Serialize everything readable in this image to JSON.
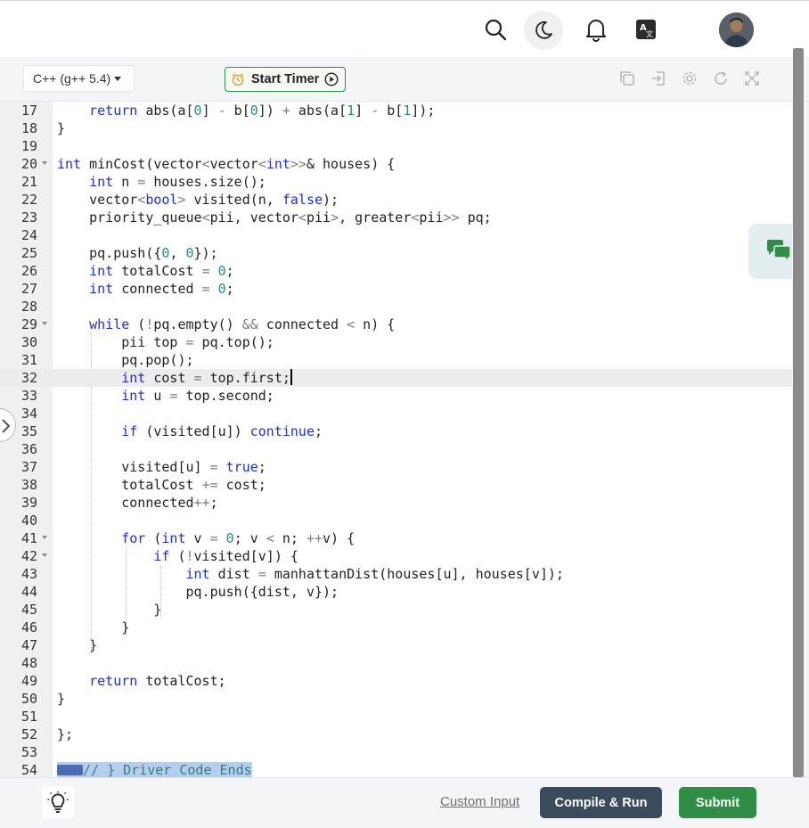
{
  "toolbar": {
    "language": "C++ (g++ 5.4)",
    "timer_label": "Start Timer"
  },
  "icons": {
    "search": "search-icon",
    "theme": "moon-icon",
    "notifications": "bell-icon",
    "translate": "translate-icon",
    "copy": "copy-icon",
    "import": "import-icon",
    "settings": "gear-icon",
    "reset": "refresh-icon",
    "fullscreen": "expand-icon",
    "chat": "chat-icon",
    "hint": "lightbulb-icon"
  },
  "editor": {
    "active_line": "32",
    "lines": [
      {
        "n": "17",
        "text": "    return abs(a[0] - b[0]) + abs(a[1] - b[1]);"
      },
      {
        "n": "18",
        "text": "}"
      },
      {
        "n": "19",
        "text": ""
      },
      {
        "n": "20",
        "text": "int minCost(vector<vector<int>>& houses) {"
      },
      {
        "n": "21",
        "text": "    int n = houses.size();"
      },
      {
        "n": "22",
        "text": "    vector<bool> visited(n, false);"
      },
      {
        "n": "23",
        "text": "    priority_queue<pii, vector<pii>, greater<pii>> pq;"
      },
      {
        "n": "24",
        "text": ""
      },
      {
        "n": "25",
        "text": "    pq.push({0, 0});"
      },
      {
        "n": "26",
        "text": "    int totalCost = 0;"
      },
      {
        "n": "27",
        "text": "    int connected = 0;"
      },
      {
        "n": "28",
        "text": ""
      },
      {
        "n": "29",
        "text": "    while (!pq.empty() && connected < n) {"
      },
      {
        "n": "30",
        "text": "        pii top = pq.top();"
      },
      {
        "n": "31",
        "text": "        pq.pop();"
      },
      {
        "n": "32",
        "text": "        int cost = top.first;"
      },
      {
        "n": "33",
        "text": "        int u = top.second;"
      },
      {
        "n": "34",
        "text": ""
      },
      {
        "n": "35",
        "text": "        if (visited[u]) continue;"
      },
      {
        "n": "36",
        "text": ""
      },
      {
        "n": "37",
        "text": "        visited[u] = true;"
      },
      {
        "n": "38",
        "text": "        totalCost += cost;"
      },
      {
        "n": "39",
        "text": "        connected++;"
      },
      {
        "n": "40",
        "text": ""
      },
      {
        "n": "41",
        "text": "        for (int v = 0; v < n; ++v) {"
      },
      {
        "n": "42",
        "text": "            if (!visited[v]) {"
      },
      {
        "n": "43",
        "text": "                int dist = manhattanDist(houses[u], houses[v]);"
      },
      {
        "n": "44",
        "text": "                pq.push({dist, v});"
      },
      {
        "n": "45",
        "text": "            }"
      },
      {
        "n": "46",
        "text": "        }"
      },
      {
        "n": "47",
        "text": "    }"
      },
      {
        "n": "48",
        "text": ""
      },
      {
        "n": "49",
        "text": "    return totalCost;"
      },
      {
        "n": "50",
        "text": "}"
      },
      {
        "n": "51",
        "text": ""
      },
      {
        "n": "52",
        "text": "};"
      },
      {
        "n": "53",
        "text": ""
      },
      {
        "n": "54",
        "text": "// } Driver Code Ends"
      }
    ]
  },
  "footer": {
    "custom_input_label": "Custom Input",
    "compile_label": "Compile & Run",
    "submit_label": "Submit"
  },
  "colors": {
    "accent_green": "#2f8d46",
    "compile_button": "#3a4b5b",
    "keyword": "#1d2fc9",
    "number": "#2a8a8a"
  }
}
